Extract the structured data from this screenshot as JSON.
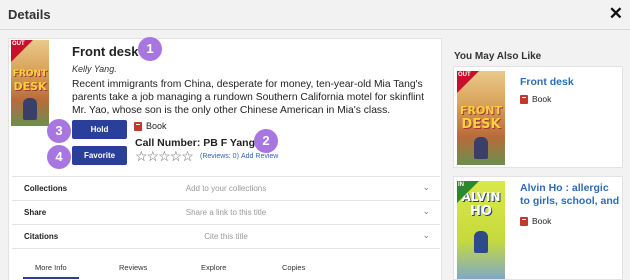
{
  "header": {
    "title": "Details",
    "close_label": "✕"
  },
  "book": {
    "ribbon": "OUT",
    "cover_word_1": "FRONT",
    "cover_word_2": "DESK",
    "title": "Front desk",
    "author": "Kelly Yang.",
    "summary": "Recent immigrants from China, desperate for money, ten-year-old Mia Tang's parents take a job managing a rundown Southern California motel for skinflint Mr. Yao, whose son is the only other Chinese American in Mia's class.",
    "format": "Book",
    "call_number": "Call Number: PB F Yang",
    "stars": "☆☆☆☆☆",
    "reviews": "(Reviews: 0)",
    "add_review": "Add Review"
  },
  "badges": [
    "1",
    "2",
    "3",
    "4"
  ],
  "buttons": {
    "hold": "Hold",
    "favorite": "Favorite"
  },
  "rows": [
    {
      "label": "Collections",
      "hint": "Add to your collections"
    },
    {
      "label": "Share",
      "hint": "Share a link to this title"
    },
    {
      "label": "Citations",
      "hint": "Cite this title"
    }
  ],
  "tabs": [
    "More Info",
    "Reviews",
    "Explore",
    "Copies"
  ],
  "sidebar": {
    "title": "You May Also Like",
    "items": [
      {
        "ribbon": "OUT",
        "cover_word_1": "FRONT",
        "cover_word_2": "DESK",
        "title": "Front desk",
        "format": "Book"
      },
      {
        "ribbon": "IN",
        "cover_word_1": "ALVIN",
        "cover_word_2": "HO",
        "title": "Alvin Ho : allergic to girls, school, and",
        "format": "Book"
      }
    ]
  },
  "colors": {
    "accent": "#2a3f9a",
    "badge": "#a776e0",
    "link": "#2d6cb5",
    "out_ribbon": "#c8102e",
    "in_ribbon": "#2a8a2a"
  }
}
